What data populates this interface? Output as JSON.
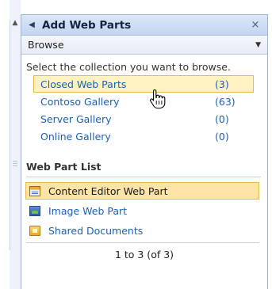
{
  "pane": {
    "title": "Add Web Parts",
    "browse_label": "Browse",
    "instruction": "Select the collection you want to browse.",
    "collections": [
      {
        "name": "Closed Web Parts",
        "count": "(3)",
        "selected": true
      },
      {
        "name": "Contoso Gallery",
        "count": "(63)",
        "selected": false
      },
      {
        "name": "Server Gallery",
        "count": "(0)",
        "selected": false
      },
      {
        "name": "Online Gallery",
        "count": "(0)",
        "selected": false
      }
    ],
    "webpart_list_title": "Web Part List",
    "webparts": [
      {
        "name": "Content Editor Web Part",
        "icon": "content-editor-icon",
        "selected": true
      },
      {
        "name": "Image Web Part",
        "icon": "image-icon",
        "selected": false
      },
      {
        "name": "Shared Documents",
        "icon": "folder-icon",
        "selected": false
      }
    ],
    "pager_text": "1 to 3 (of 3)"
  },
  "colors": {
    "selected_fill": "#fff2c2",
    "selected_border": "#e6bb50",
    "link": "#1d60b3",
    "header": "#c3d5f1"
  }
}
